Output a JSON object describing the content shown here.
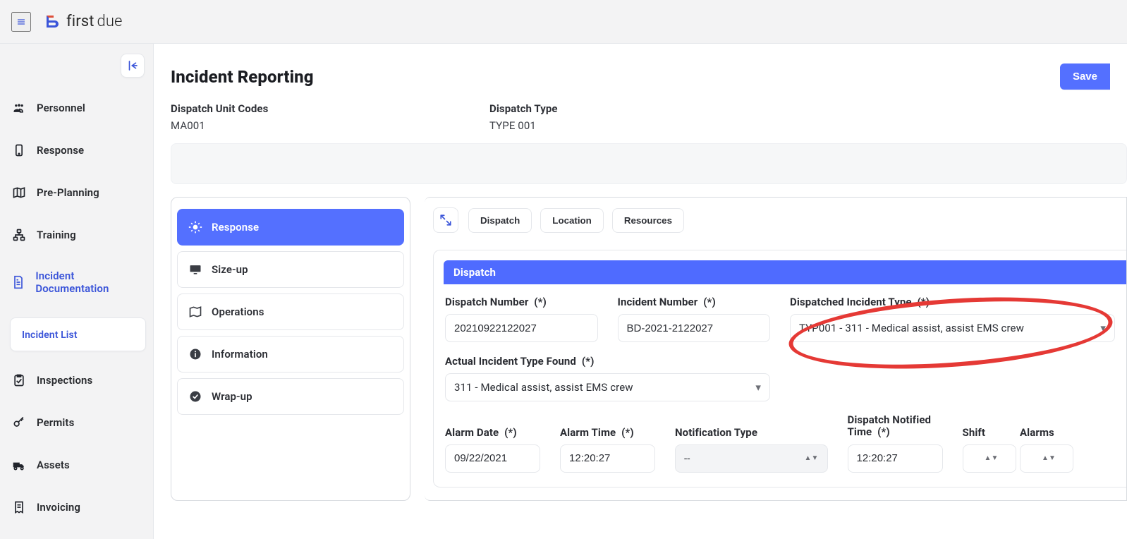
{
  "brand": {
    "name1": "first",
    "name2": "due"
  },
  "sidebar": {
    "items": [
      {
        "label": "Personnel",
        "icon": "people-icon"
      },
      {
        "label": "Response",
        "icon": "device-icon"
      },
      {
        "label": "Pre-Planning",
        "icon": "map-icon"
      },
      {
        "label": "Training",
        "icon": "diagram-icon"
      },
      {
        "label": "Incident Documentation",
        "icon": "doc-icon",
        "active": true,
        "sub": {
          "label": "Incident List"
        }
      },
      {
        "label": "Inspections",
        "icon": "check-icon"
      },
      {
        "label": "Permits",
        "icon": "key-icon"
      },
      {
        "label": "Assets",
        "icon": "truck-icon"
      },
      {
        "label": "Invoicing",
        "icon": "receipt-icon"
      }
    ]
  },
  "page": {
    "title": "Incident Reporting",
    "save": "Save"
  },
  "header": {
    "col1": {
      "label": "Dispatch Unit Codes",
      "value": "MA001"
    },
    "col2": {
      "label": "Dispatch Type",
      "value": "TYPE 001"
    }
  },
  "steps": [
    {
      "label": "Response",
      "active": true,
      "icon": "bug-icon"
    },
    {
      "label": "Size-up",
      "icon": "monitor-icon"
    },
    {
      "label": "Operations",
      "icon": "ops-icon"
    },
    {
      "label": "Information",
      "icon": "info-icon"
    },
    {
      "label": "Wrap-up",
      "icon": "done-icon"
    }
  ],
  "form": {
    "tabs": [
      "Dispatch",
      "Location",
      "Resources"
    ],
    "section": "Dispatch",
    "fields": {
      "dispatch_number": {
        "label": "Dispatch Number",
        "req": "(*)",
        "value": "20210922122027"
      },
      "incident_number": {
        "label": "Incident Number",
        "req": "(*)",
        "value": "BD-2021-2122027"
      },
      "dispatched_incident_type": {
        "label": "Dispatched Incident Type",
        "req": "(*)",
        "value": "TYP001 - 311 - Medical assist, assist EMS crew"
      },
      "actual_incident_type": {
        "label": "Actual Incident Type Found",
        "req": "(*)",
        "value": "311 - Medical assist, assist EMS crew"
      },
      "alarm_date": {
        "label": "Alarm Date",
        "req": "(*)",
        "value": "09/22/2021"
      },
      "alarm_time": {
        "label": "Alarm Time",
        "req": "(*)",
        "value": "12:20:27"
      },
      "notification_type": {
        "label": "Notification Type",
        "value": "--"
      },
      "dispatch_notified_time": {
        "label": "Dispatch Notified Time",
        "req": "(*)",
        "value": "12:20:27"
      },
      "shift": {
        "label": "Shift",
        "value": ""
      },
      "alarms": {
        "label": "Alarms",
        "value": ""
      }
    }
  },
  "colors": {
    "primary": "#5470ff",
    "annotation": "#e53935"
  }
}
